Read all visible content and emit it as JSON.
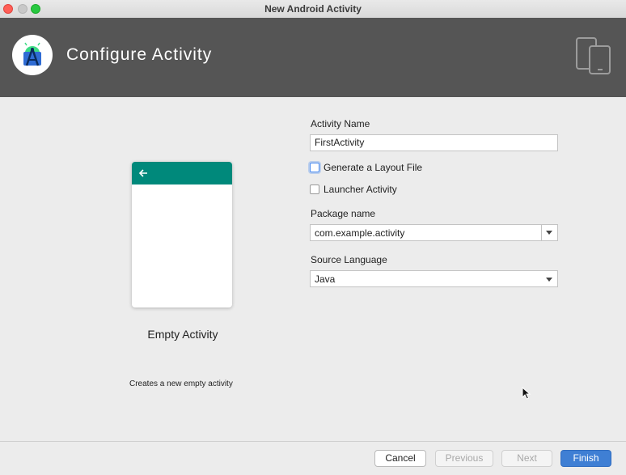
{
  "window": {
    "title": "New Android Activity"
  },
  "header": {
    "title": "Configure Activity",
    "logo_icon": "android-studio-icon",
    "devices_icon": "devices-icon"
  },
  "template": {
    "name": "Empty Activity",
    "description": "Creates a new empty activity",
    "appbar_color": "#00897b"
  },
  "form": {
    "activity_name_label": "Activity Name",
    "activity_name_value": "FirstActivity",
    "generate_layout_label": "Generate a Layout File",
    "generate_layout_checked": false,
    "launcher_activity_label": "Launcher Activity",
    "launcher_activity_checked": false,
    "package_name_label": "Package name",
    "package_name_value": "com.example.activity",
    "source_language_label": "Source Language",
    "source_language_value": "Java"
  },
  "footer": {
    "cancel_label": "Cancel",
    "previous_label": "Previous",
    "next_label": "Next",
    "finish_label": "Finish"
  },
  "colors": {
    "header_bg": "#555555",
    "primary_button": "#3f7fd4"
  }
}
